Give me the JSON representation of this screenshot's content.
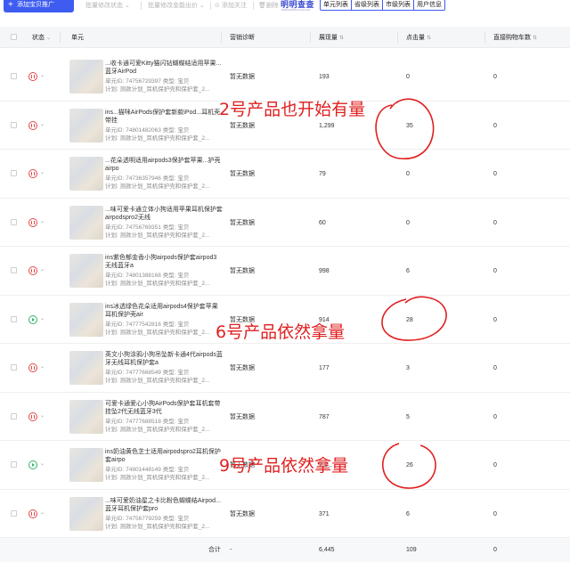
{
  "toolbar": {
    "add_button": "添加宝贝推广",
    "batch_edit_status": "批量修改状态",
    "batch_edit_bid": "批量修改金能出价",
    "add_follow": "添加关注",
    "delete": "删除",
    "logo": "明明查查",
    "logo_sub": "MINGMINGCHACHA",
    "tabs": [
      "单元列表",
      "省级列表",
      "市级列表",
      "用户信息"
    ]
  },
  "table": {
    "headers": {
      "status": "状态",
      "unit": "单元",
      "diagnosis": "营销诊断",
      "impressions": "展现量",
      "clicks": "点击量",
      "cart": "直接购物车数"
    },
    "meta_labels": {
      "unit_id": "单元ID:",
      "type": "类型:",
      "type_value": "宝贝",
      "plan": "计划:"
    },
    "rows": [
      {
        "title": "...收卡通可爱Kitty猫闪钻蝴蝶结适用苹果...蓝牙AirPod",
        "unit_id": "74756729397",
        "plan": "测款计划_耳机保护壳和保护套_2...",
        "diagnosis": "暂无数据",
        "impressions": "193",
        "clicks": "0",
        "cart": "0",
        "status": "paused"
      },
      {
        "title": "ins...猫咪AirPods保护套新款iPod...耳机壳带挂",
        "unit_id": "74801482063",
        "plan": "测款计划_耳机保护壳和保护套_2...",
        "diagnosis": "暂无数据",
        "impressions": "1,299",
        "clicks": "35",
        "cart": "0",
        "status": "paused"
      },
      {
        "title": "...花朵透明适用airpods3保护套苹果...护壳airpo",
        "unit_id": "74736357946",
        "plan": "测款计划_耳机保护壳和保护套_2...",
        "diagnosis": "暂无数据",
        "impressions": "79",
        "clicks": "0",
        "cart": "0",
        "status": "paused"
      },
      {
        "title": "...味可爱卡通立体小狗适用苹果耳机保护套airpodspro2无线",
        "unit_id": "74756769351",
        "plan": "测款计划_耳机保护壳和保护套_2...",
        "diagnosis": "暂无数据",
        "impressions": "60",
        "clicks": "0",
        "cart": "0",
        "status": "paused"
      },
      {
        "title": "ins紫色郁金香小狗airpods保护套airpod3无线蓝牙a",
        "unit_id": "74801388168",
        "plan": "测款计划_耳机保护壳和保护套_2...",
        "diagnosis": "暂无数据",
        "impressions": "998",
        "clicks": "6",
        "cart": "0",
        "status": "paused"
      },
      {
        "title": "ins冰透绿色花朵适用airpods4保护套苹果耳机保护壳air",
        "unit_id": "74777542816",
        "plan": "测款计划_耳机保护壳和保护套_2...",
        "diagnosis": "暂无数据",
        "impressions": "914",
        "clicks": "28",
        "cart": "0",
        "status": "active"
      },
      {
        "title": "英文小狗涂鸦小狗吊坠新卡通4代airpods蓝牙无线耳机保护套a",
        "unit_id": "74777668549",
        "plan": "测款计划_耳机保护壳和保护套_2...",
        "diagnosis": "暂无数据",
        "impressions": "177",
        "clicks": "3",
        "cart": "0",
        "status": "paused"
      },
      {
        "title": "可爱卡通爱心小狗AirPods保护套耳机套带挂坠2代无线蓝牙3代",
        "unit_id": "74777688518",
        "plan": "测款计划_耳机保护壳和保护套_2...",
        "diagnosis": "暂无数据",
        "impressions": "787",
        "clicks": "5",
        "cart": "0",
        "status": "paused"
      },
      {
        "title": "ins奶油黄色芝士适用airpodspro2耳机保护套airpo",
        "unit_id": "74801448149",
        "plan": "测款计划_耳机保护壳和保护套_2...",
        "diagnosis": "暂无数据",
        "impressions": "2,1...",
        "clicks": "26",
        "cart": "0",
        "status": "active"
      },
      {
        "title": "...味可爱奶油星之卡比粉色蝴蝶结Airpod...蓝牙耳机保护套pro",
        "unit_id": "74756779259",
        "plan": "测款计划_耳机保护壳和保护套_2...",
        "diagnosis": "暂无数据",
        "impressions": "371",
        "clicks": "6",
        "cart": "0",
        "status": "paused"
      }
    ],
    "footer": {
      "label": "合计",
      "diagnosis": "-",
      "impressions": "6,445",
      "clicks": "109",
      "cart": "0"
    }
  },
  "annotations": [
    "2号产品也开始有量",
    "6号产品依然拿量",
    "9号产品依然拿量"
  ],
  "colors": {
    "accent": "#3e5cf0",
    "annotation": "#e02020",
    "paused": "#e04848",
    "active": "#2fb56a"
  }
}
